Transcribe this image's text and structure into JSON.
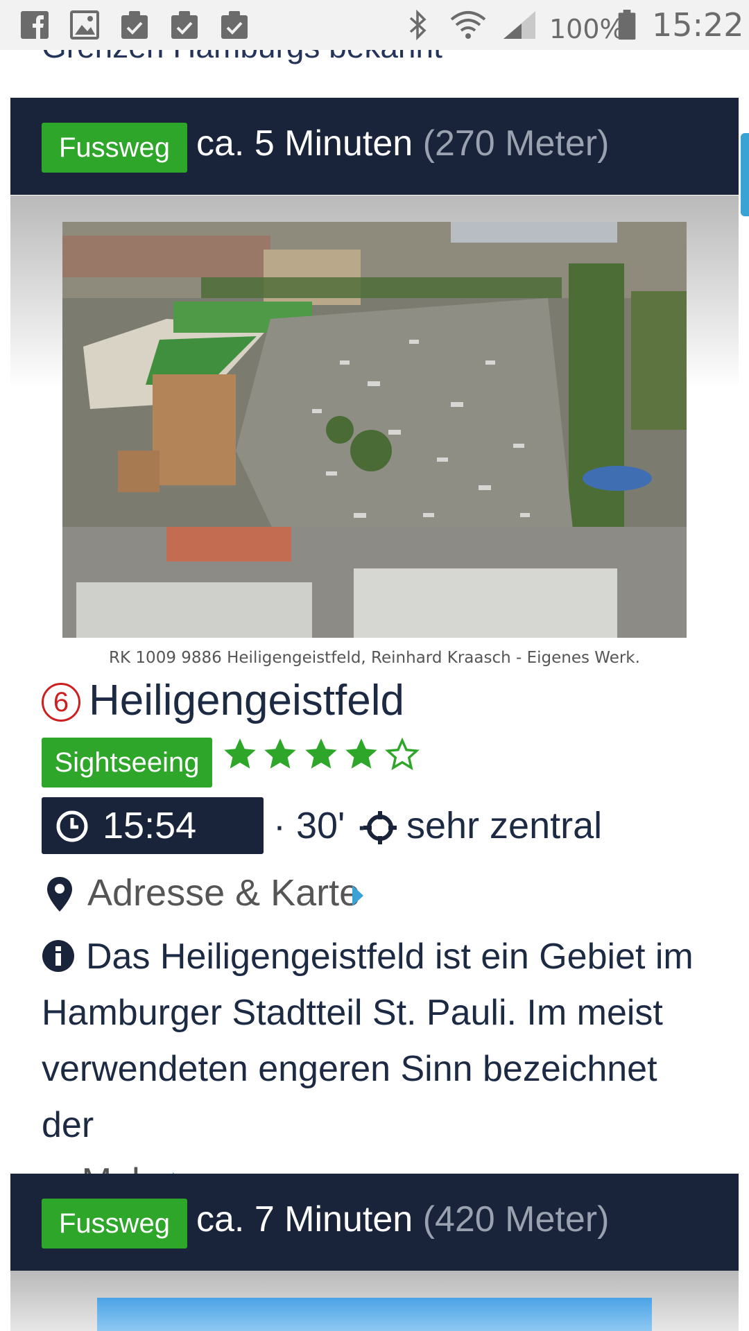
{
  "status_bar": {
    "battery_percent": "100%",
    "time": "15:22"
  },
  "previous_section": {
    "heading_fragment": "Grenzen Hamburgs bekannt"
  },
  "route_1": {
    "mode": "Fussweg",
    "time": "ca. 5 Minuten",
    "distance": "(270 Meter)"
  },
  "place": {
    "image_caption": "RK 1009 9886 Heiligengeistfeld, Reinhard Kraasch - Eigenes Werk.",
    "number": "6",
    "title": "Heiligengeistfeld",
    "category": "Sightseeing",
    "rating": 4,
    "rating_max": 5,
    "arrival_time": "15:54 Uhr",
    "duration": "· 30' ·",
    "location_label": "sehr zentral",
    "address_link": "Adresse & Karte",
    "description": "Das Heiligengeistfeld ist ein Gebiet im Hamburger Stadtteil St. Pauli. Im meist verwendeten engeren Sinn bezeichnet der",
    "ellipsis": "...",
    "more_label": "Mehr"
  },
  "route_2": {
    "mode": "Fussweg",
    "time": "ca. 7 Minuten",
    "distance": "(420 Meter)"
  },
  "colors": {
    "navy": "#19233a",
    "green": "#2ea62a",
    "accent_blue": "#3aa3d6",
    "red": "#cc1f1f"
  }
}
